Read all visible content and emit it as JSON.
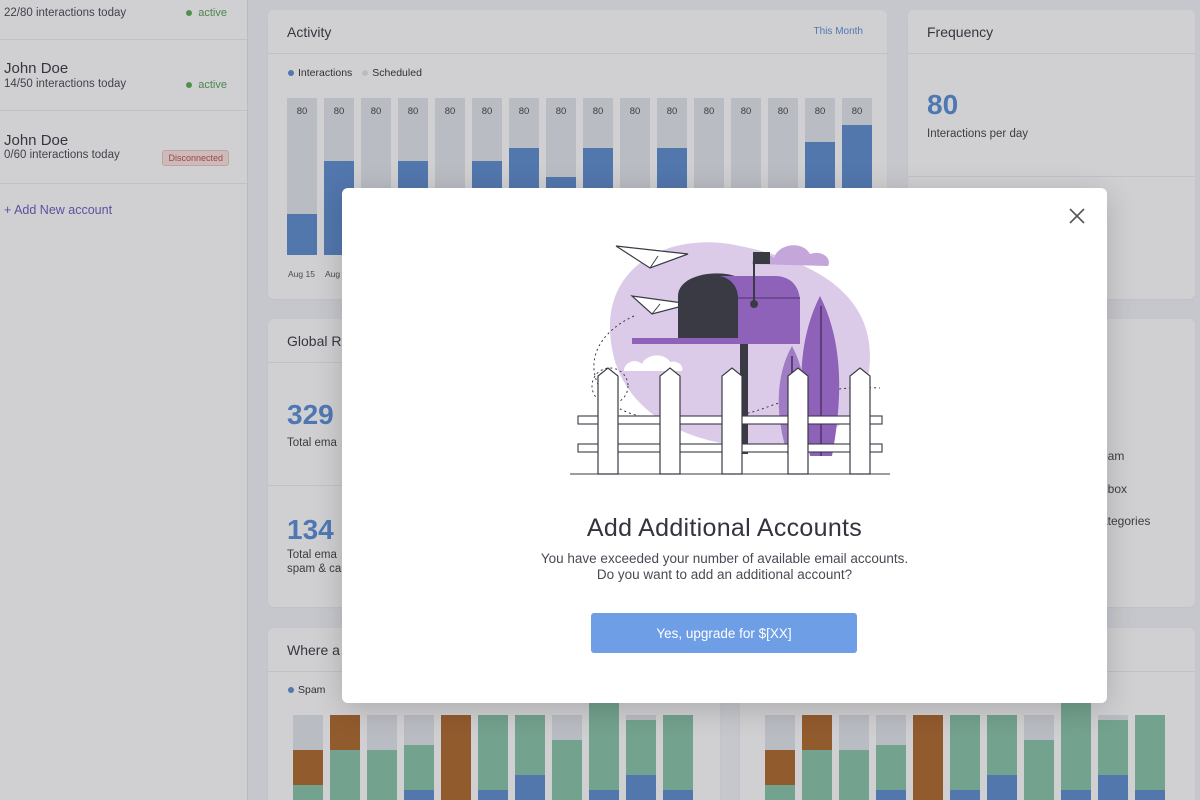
{
  "accounts": [
    {
      "name": "",
      "sub": "22/80 interactions today",
      "status": "active"
    },
    {
      "name": "John Doe",
      "sub": "14/50 interactions today",
      "status": "active"
    },
    {
      "name": "John Doe",
      "sub": "0/60 interactions today",
      "status": "Disconnected"
    }
  ],
  "add_account_label": "+ Add New account",
  "activity": {
    "title": "Activity",
    "period_link": "This Month",
    "legend": [
      {
        "label": "Interactions",
        "color": "#5e8ed0"
      },
      {
        "label": "Scheduled",
        "color": "#e3e6ec"
      }
    ]
  },
  "chart_data": [
    {
      "type": "bar",
      "title": "Activity",
      "series": [
        {
          "name": "Interactions",
          "values": [
            26,
            60,
            0,
            60,
            0,
            60,
            68,
            50,
            68,
            0,
            68,
            0,
            0,
            0,
            72,
            83
          ]
        },
        {
          "name": "Scheduled",
          "values": [
            80,
            80,
            80,
            80,
            80,
            80,
            80,
            80,
            80,
            80,
            80,
            80,
            80,
            80,
            80,
            80
          ]
        }
      ],
      "data_labels": [
        "80",
        "80",
        "80",
        "80",
        "80",
        "80",
        "80",
        "80",
        "80",
        "80",
        "80",
        "80",
        "80",
        "80",
        "80",
        "80"
      ],
      "x_tick_labels_visible": [
        "Aug 15",
        "Aug"
      ],
      "ylim": [
        0,
        100
      ],
      "grid": false,
      "legend_position": "top-left"
    },
    {
      "type": "bar",
      "title": "Where a",
      "stacked": true,
      "legend_visible": [
        "Spam"
      ],
      "series": [
        {
          "name": "Spam",
          "values": [
            0,
            0,
            0,
            25,
            0,
            25,
            40,
            0,
            25,
            40,
            25
          ]
        },
        {
          "name": "",
          "values": [
            30,
            65,
            65,
            45,
            10,
            75,
            60,
            75,
            95,
            55,
            75
          ]
        },
        {
          "name": "",
          "values": [
            35,
            35,
            0,
            0,
            90,
            0,
            0,
            0,
            0,
            0,
            0
          ]
        },
        {
          "name": "",
          "values": [
            35,
            0,
            35,
            30,
            0,
            0,
            0,
            25,
            0,
            5,
            0
          ]
        }
      ],
      "colors": [
        "#5e8ed0",
        "#88c4a8",
        "#b0692e",
        "#e3e6ec"
      ],
      "ylim": [
        0,
        100
      ]
    },
    {
      "type": "bar",
      "stacked": true,
      "series": [
        {
          "name": "",
          "values": [
            0,
            0,
            0,
            25,
            0,
            25,
            40,
            0,
            25,
            40,
            25
          ]
        },
        {
          "name": "",
          "values": [
            30,
            65,
            65,
            45,
            10,
            75,
            60,
            75,
            95,
            55,
            75
          ]
        },
        {
          "name": "",
          "values": [
            35,
            35,
            0,
            0,
            90,
            0,
            0,
            0,
            0,
            0,
            0
          ]
        },
        {
          "name": "",
          "values": [
            35,
            0,
            35,
            30,
            0,
            0,
            0,
            25,
            0,
            5,
            0
          ]
        }
      ],
      "colors": [
        "#5e8ed0",
        "#88c4a8",
        "#b0692e",
        "#e3e6ec"
      ],
      "ylim": [
        0,
        100
      ]
    }
  ],
  "frequency": {
    "title": "Frequency",
    "value": "80",
    "label": "Interactions per day"
  },
  "global": {
    "title": "Global R",
    "stat1_value": "329",
    "stat1_label": "Total ema",
    "stat2_value": "134",
    "stat2_label_line1": "Total ema",
    "stat2_label_line2": "spam & ca"
  },
  "right_list": [
    "pam",
    "nbox",
    "ategories"
  ],
  "where_title": "Where a",
  "where_legend": "Spam",
  "modal": {
    "title": "Add Additional Accounts",
    "line1": "You have exceeded your number of available email accounts.",
    "line2": "Do you want to add an additional account?",
    "cta": "Yes, upgrade for $[XX]",
    "close_icon": "close-icon",
    "illustration": "mailbox-illustration"
  },
  "colors": {
    "accent": "#6e9fe6",
    "interactions": "#5e8ed0",
    "scheduled": "#e3e6ec",
    "purple": "#8e62b8",
    "active": "#5cab5c",
    "disconnected": "#c0504d"
  }
}
